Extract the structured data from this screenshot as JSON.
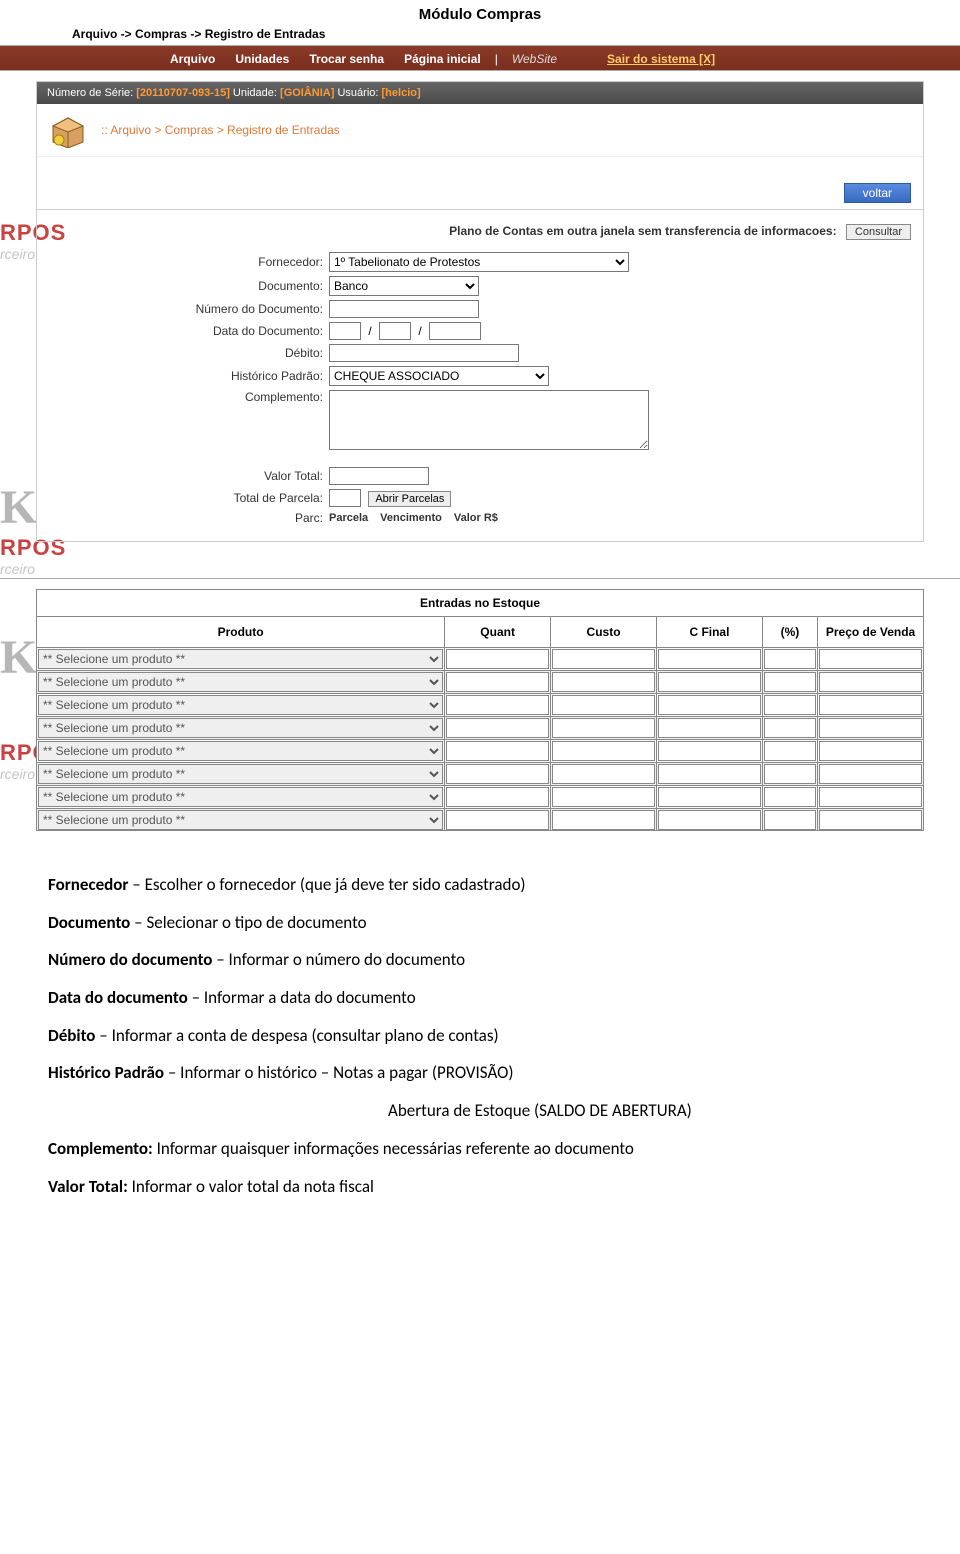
{
  "page": {
    "title": "Módulo Compras",
    "breadcrumb_top": "Arquivo -> Compras -> Registro de Entradas"
  },
  "topnav": {
    "items": [
      "Arquivo",
      "Unidades",
      "Trocar senha",
      "Página inicial"
    ],
    "divider": "|",
    "website": "WebSite",
    "logout": "Sair do sistema [X]"
  },
  "infobar": {
    "serial_label": "Número de Série:",
    "serial_value": "[20110707-093-15]",
    "unidade_label": "Unidade:",
    "unidade_value": "[GOIÂNIA]",
    "usuario_label": "Usuário:",
    "usuario_value": "[helcio]"
  },
  "crumb": {
    "text": ":: Arquivo > Compras > Registro de Entradas"
  },
  "buttons": {
    "voltar": "voltar",
    "consultar": "Consultar",
    "abrir_parcelas": "Abrir Parcelas"
  },
  "labels": {
    "plano_contas": "Plano de Contas em outra janela sem transferencia de informacoes:",
    "fornecedor": "Fornecedor:",
    "documento": "Documento:",
    "numero_doc": "Número do Documento:",
    "data_doc": "Data do Documento:",
    "debito": "Débito:",
    "historico": "Histórico Padrão:",
    "complemento": "Complemento:",
    "valor_total": "Valor Total:",
    "total_parcela": "Total de Parcela:",
    "parc": "Parc:",
    "parc_parcela": "Parcela",
    "parc_venc": "Vencimento",
    "parc_valor": "Valor R$"
  },
  "form": {
    "fornecedor_selected": "1º Tabelionato de Protestos",
    "documento_selected": "Banco",
    "numero_doc": "",
    "data_d": "",
    "data_m": "",
    "data_y": "",
    "debito": "",
    "historico_selected": "CHEQUE ASSOCIADO",
    "complemento": "",
    "valor_total": "",
    "total_parcela": ""
  },
  "stock": {
    "title": "Entradas no Estoque",
    "headers": {
      "produto": "Produto",
      "quant": "Quant",
      "custo": "Custo",
      "cfinal": "C Final",
      "pct": "(%)",
      "preco": "Preço de Venda"
    },
    "placeholder": "** Selecione um produto **",
    "row_count": 8
  },
  "doc": {
    "p1_strong": "Fornecedor",
    "p1_rest": " – Escolher o fornecedor (que já deve ter sido cadastrado)",
    "p2_strong": "Documento",
    "p2_rest": " – Selecionar o tipo de documento",
    "p3_strong": "Número do documento",
    "p3_rest": " – Informar o número do documento",
    "p4_strong": "Data do documento",
    "p4_rest": " – Informar a data do documento",
    "p5_strong": "Débito",
    "p5_rest": " – Informar a conta de despesa (consultar plano de contas)",
    "p6_strong": "Histórico Padrão",
    "p6_rest": " – Informar o histórico – Notas a pagar (PROVISÃO)",
    "p7": "Abertura de Estoque (SALDO DE ABERTURA)",
    "p8_strong": "Complemento:",
    "p8_rest": " Informar quaisquer informações necessárias referente ao documento",
    "p9_strong": "Valor Total:",
    "p9_rest": " Informar o valor total da nota fiscal"
  }
}
